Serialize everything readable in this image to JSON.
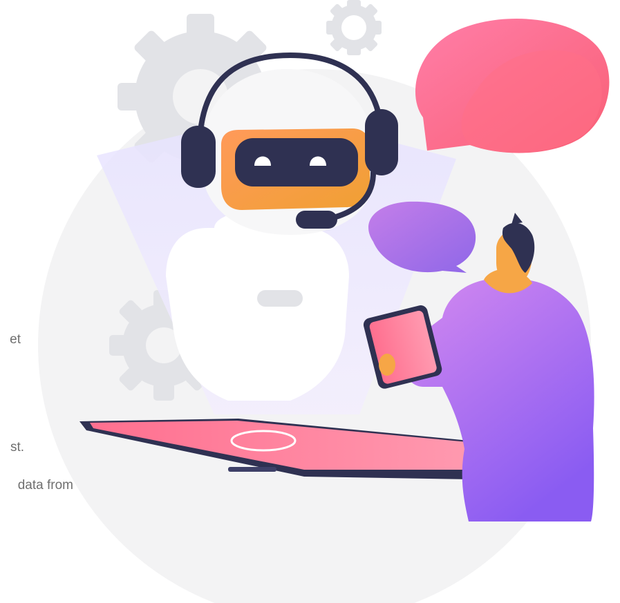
{
  "background_text": {
    "fragment_1": "et",
    "fragment_2": "st.",
    "fragment_3": "data from"
  },
  "illustration": {
    "robot_agent": {
      "headset": "headset-icon",
      "visor": "robot-visor-icon"
    },
    "speech_bubble_large": {
      "color": "#fb6f8e"
    },
    "speech_bubble_small": {
      "color": "#a86ee6"
    },
    "gears": [
      "gear-icon",
      "gear-icon",
      "gear-icon"
    ],
    "tablet": {
      "color": "#ff8aa4"
    },
    "person": {
      "shirt_color": "#b56bf0",
      "device": "tablet-device-icon"
    }
  },
  "colors": {
    "circle_bg": "#f3f3f4",
    "gear": "#e2e3e7",
    "navy": "#2f3152",
    "orange": "#f5a23e",
    "pink": "#fb6f8e",
    "purple": "#a86ee6",
    "skin": "#f6a646"
  }
}
